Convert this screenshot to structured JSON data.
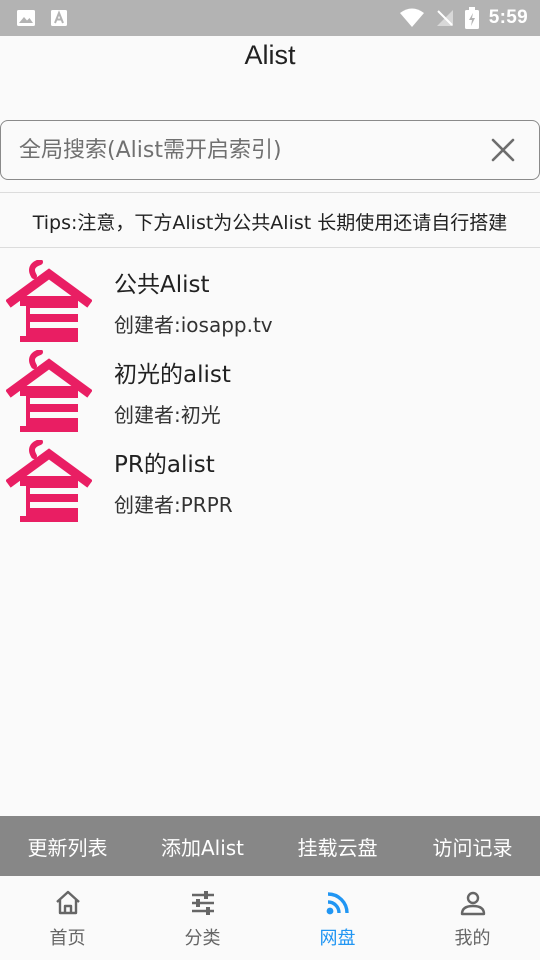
{
  "app": {
    "title": "Alist"
  },
  "status_bar": {
    "time": "5:59",
    "icons": [
      "image-icon",
      "text-a-icon",
      "wifi-icon",
      "no-signal-icon",
      "battery-charging-icon"
    ]
  },
  "search": {
    "placeholder": "全局搜索(Alist需开启索引)",
    "value": ""
  },
  "tips": "Tips:注意，下方Alist为公共Alist 长期使用还请自行搭建",
  "items": [
    {
      "name": "公共Alist",
      "creator": "创建者:iosapp.tv"
    },
    {
      "name": "初光的alist",
      "creator": "创建者:初光"
    },
    {
      "name": "PR的alist",
      "creator": "创建者:PRPR"
    }
  ],
  "actions": {
    "update": "更新列表",
    "add": "添加Alist",
    "mount": "挂载云盘",
    "history": "访问记录"
  },
  "nav": {
    "home": "首页",
    "category": "分类",
    "netdisk": "网盘",
    "mine": "我的",
    "active": "netdisk"
  },
  "colors": {
    "accent": "#2196f3",
    "logo": "#e91e63",
    "action_bar": "#878787",
    "status_bar": "#b3b3b3"
  }
}
